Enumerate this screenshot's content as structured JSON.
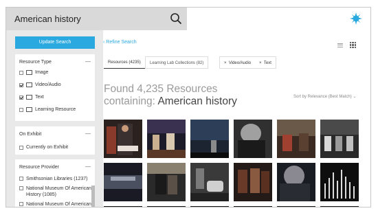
{
  "search": {
    "query": "American history"
  },
  "sidebar": {
    "update_button": "Update Search",
    "resource_type": {
      "heading": "Resource Type",
      "collapse": "—",
      "items": [
        {
          "label": "Image",
          "checked": false,
          "icon": "image-icon"
        },
        {
          "label": "Video/Audio",
          "checked": true,
          "icon": "video-icon"
        },
        {
          "label": "Text",
          "checked": true,
          "icon": "text-icon"
        },
        {
          "label": "Learning Resource",
          "checked": false,
          "icon": "book-icon"
        }
      ]
    },
    "on_exhibit": {
      "heading": "On Exhibit",
      "collapse": "—",
      "items": [
        {
          "label": "Currently on Exhibit",
          "checked": false
        }
      ]
    },
    "resource_provider": {
      "heading": "Resource Provider",
      "collapse": "—",
      "items": [
        {
          "label": "Smithsonian Libraries (1237)",
          "checked": false
        },
        {
          "label": "National Museum Of American History (1085)",
          "checked": false
        },
        {
          "label": "National Museum Of American History, Kenneth",
          "checked": false
        }
      ]
    }
  },
  "main": {
    "refine_link": "Refine Search",
    "tabs": [
      {
        "label": "Resources (4235)",
        "active": true
      },
      {
        "label": "Learning Lab Collections (82)",
        "active": false
      }
    ],
    "filter_chips": [
      {
        "label": "Video/Audio",
        "remove": "×"
      },
      {
        "label": "Text",
        "remove": "×"
      }
    ],
    "results_heading_line1": "Found 4,235 Resources",
    "results_heading_prefix": "containing: ",
    "results_heading_query": "American history",
    "sort_label": "Sort by Relevance (Best Match)",
    "sort_chevron": "⌄"
  },
  "colors": {
    "accent": "#2aa8e0",
    "sidebar_bg": "#e9e9e9",
    "search_bg": "#d9d9d9"
  }
}
